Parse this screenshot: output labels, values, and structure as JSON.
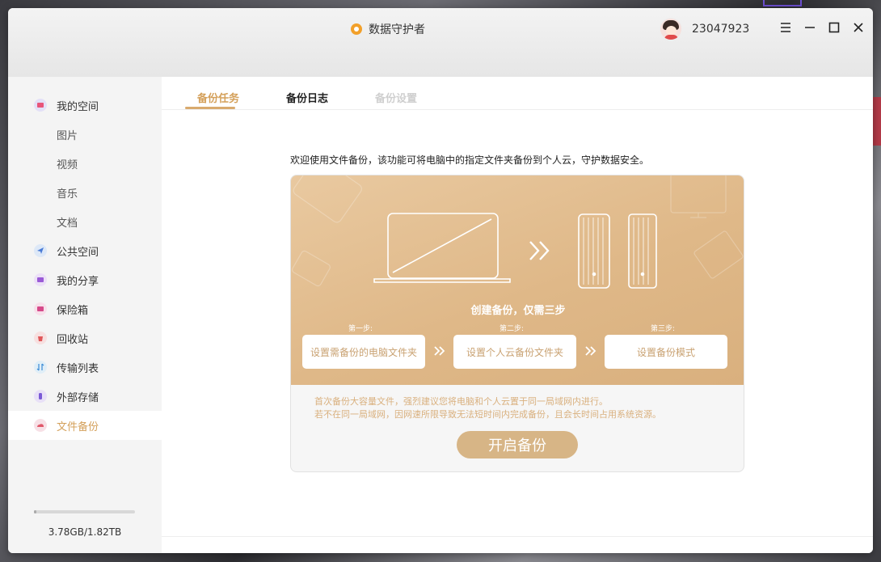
{
  "app": {
    "title": "数据守护者"
  },
  "user": {
    "name": "23047923"
  },
  "sidebar": {
    "items": [
      {
        "label": "我的空间",
        "icon": "my-space-icon"
      },
      {
        "label": "图片",
        "icon": ""
      },
      {
        "label": "视频",
        "icon": ""
      },
      {
        "label": "音乐",
        "icon": ""
      },
      {
        "label": "文档",
        "icon": ""
      },
      {
        "label": "公共空间",
        "icon": "public-space-icon"
      },
      {
        "label": "我的分享",
        "icon": "share-icon"
      },
      {
        "label": "保险箱",
        "icon": "safe-box-icon"
      },
      {
        "label": "回收站",
        "icon": "trash-icon"
      },
      {
        "label": "传输列表",
        "icon": "transfer-icon"
      },
      {
        "label": "外部存储",
        "icon": "external-storage-icon"
      },
      {
        "label": "文件备份",
        "icon": "file-backup-icon"
      }
    ],
    "storage": {
      "text": "3.78GB/1.82TB",
      "used_fraction": 0.002
    }
  },
  "tabs": [
    {
      "label": "备份任务",
      "state": "active"
    },
    {
      "label": "备份日志",
      "state": "normal"
    },
    {
      "label": "备份设置",
      "state": "disabled"
    }
  ],
  "backup": {
    "intro": "欢迎使用文件备份，该功能可将电脑中的指定文件夹备份到个人云，守护数据安全。",
    "steps_title": "创建备份，仅需三步",
    "steps": [
      {
        "label": "第一步:",
        "action": "设置需备份的电脑文件夹"
      },
      {
        "label": "第二步:",
        "action": "设置个人云备份文件夹"
      },
      {
        "label": "第三步:",
        "action": "设置备份模式"
      }
    ],
    "notice_line1": "首次备份大容量文件，强烈建议您将电脑和个人云置于同一局域网内进行。",
    "notice_line2": "若不在同一局域网，因网速所限导致无法短时间内完成备份，且会长时间占用系统资源。",
    "start_button": "开启备份"
  },
  "colors": {
    "accent": "#d9aa6e",
    "card_top": "#dfb888",
    "button": "#d7b586"
  }
}
